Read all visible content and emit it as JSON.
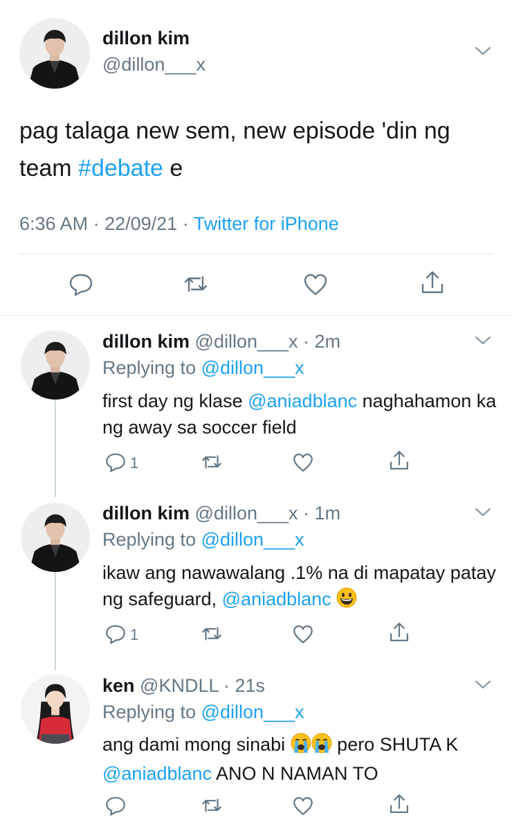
{
  "main_tweet": {
    "name": "dillon kim",
    "handle": "@dillon___x",
    "text_before": "pag talaga new sem, new episode 'din ng team ",
    "hashtag": "#debate",
    "text_after": " e",
    "time": "6:36 AM",
    "date": "22/09/21",
    "source": "Twitter for iPhone",
    "dot": "·"
  },
  "replies": [
    {
      "name": "dillon kim",
      "handle": "@dillon___x",
      "age": "2m",
      "replying_prefix": "Replying to ",
      "replying_to": "@dillon___x",
      "text_before": "first day ng klase ",
      "mention": "@aniadblanc",
      "text_after": " naghahamon ka ng away sa soccer field",
      "reply_count": "1"
    },
    {
      "name": "dillon kim",
      "handle": "@dillon___x",
      "age": "1m",
      "replying_prefix": "Replying to ",
      "replying_to": "@dillon___x",
      "text_before": "ikaw ang nawawalang .1% na di mapatay patay ng safeguard, ",
      "mention": "@aniadblanc",
      "emoji": "grinning-face",
      "reply_count": "1"
    },
    {
      "name": "ken",
      "handle": "@KNDLL",
      "age": "21s",
      "replying_prefix": "Replying to ",
      "replying_to": "@dillon___x",
      "text_before": "ang dami mong sinabi ",
      "emojis": [
        "loudly-crying-face",
        "loudly-crying-face"
      ],
      "text_middle": " pero SHUTA K ",
      "mention": "@aniadblanc",
      "text_after": " ANO N NAMAN TO",
      "reply_count": ""
    }
  ],
  "icons": {
    "reply": "reply-icon",
    "retweet": "retweet-icon",
    "like": "heart-icon",
    "share": "share-icon",
    "more": "chevron-down-icon"
  },
  "colors": {
    "link": "#1da1f2",
    "secondary": "#657786",
    "divider": "#e1e8ed"
  }
}
